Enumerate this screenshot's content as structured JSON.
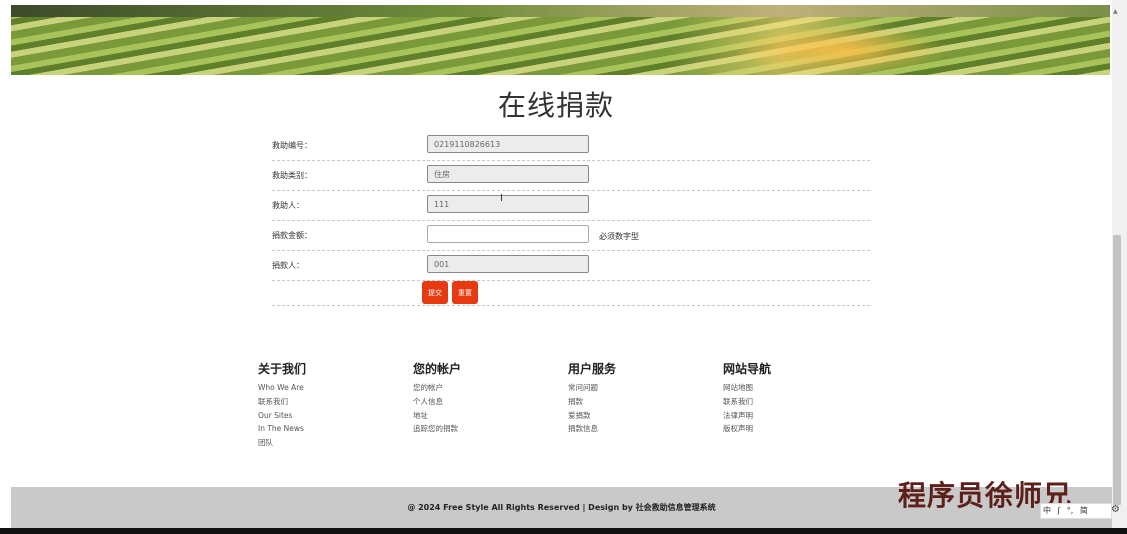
{
  "page": {
    "title": "在线捐款"
  },
  "form": {
    "rows": [
      {
        "label": "救助编号：",
        "value": "0219110826613",
        "editable": false
      },
      {
        "label": "救助类别：",
        "value": "住房",
        "editable": false
      },
      {
        "label": "救助人：",
        "value": "111",
        "editable": false
      },
      {
        "label": "捐款金额：",
        "value": "",
        "editable": true,
        "hint": "必须数字型"
      },
      {
        "label": "捐款人：",
        "value": "001",
        "editable": false
      }
    ],
    "submit_label": "提交",
    "reset_label": "重置"
  },
  "footer": {
    "columns": [
      {
        "title": "关于我们",
        "links": [
          "Who We Are",
          "联系我们",
          "Our Sites",
          "In The News",
          "团队"
        ]
      },
      {
        "title": "您的帐户",
        "links": [
          "您的帐户",
          "个人信息",
          "地址",
          "追踪您的捐款"
        ]
      },
      {
        "title": "用户服务",
        "links": [
          "常问问题",
          "捐款",
          "爱捐款",
          "捐款信息"
        ]
      },
      {
        "title": "网站导航",
        "links": [
          "网站地图",
          "联系我们",
          "法律声明",
          "版权声明"
        ]
      }
    ],
    "copyright": "@ 2024 Free Style All Rights Reserved | Design by 社会救助信息管理系统"
  },
  "watermark": "程序员徐师兄",
  "ime": {
    "items": [
      "中",
      "ʃ",
      "°,",
      "简"
    ]
  },
  "colors": {
    "accent": "#e83a10",
    "footer_bg": "#c9c9c9"
  },
  "icons": {
    "cursor": "text-cursor-icon",
    "settings": "gear-icon"
  }
}
